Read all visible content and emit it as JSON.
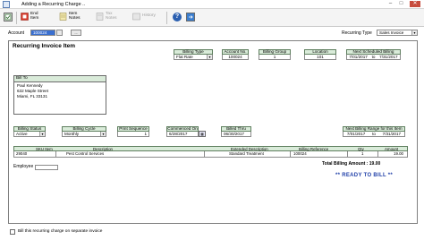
{
  "window": {
    "title": "Adding a Recurring Charge ..",
    "controls": [
      "minimize",
      "maximize",
      "close"
    ]
  },
  "toolbar": {
    "end_item_label": "End Item",
    "item_notes_label": "Item Notes",
    "tax_notes_label": "Tax Notes",
    "history_label": "History",
    "end_item_line1": "End",
    "end_item_line2": "Item",
    "item_notes_line1": "Item",
    "item_notes_line2": "Notes",
    "tax_notes_line1": "Tax",
    "tax_notes_line2": "Notes"
  },
  "account": {
    "label": "Account",
    "value": "100024",
    "recurring_type_label": "Recurring Type",
    "recurring_type_value": "Sales Invoice"
  },
  "panel": {
    "title": "Recurring Invoice Item"
  },
  "top_fields": {
    "billing_type": {
      "label": "Billing Type",
      "value": "Flat Rate"
    },
    "account_no": {
      "label": "Account No.",
      "value": "100024"
    },
    "billing_group": {
      "label": "Billing Group",
      "value": "1"
    },
    "location": {
      "label": "Location",
      "value": "101"
    },
    "next_scheduled_billing": {
      "label": "Next Scheduled Billing",
      "from": "7/01/2017",
      "to_label": "to",
      "to": "7/31/2017"
    }
  },
  "bill_to": {
    "label": "Bill To",
    "lines": [
      "Paul Kennedy",
      "632 Maple Street",
      "Miami, FL 33131"
    ]
  },
  "mid_fields": {
    "billing_status": {
      "label": "Billing Status",
      "value": "Active"
    },
    "billing_cycle": {
      "label": "Billing Cycle",
      "value": "Monthly"
    },
    "print_sequence": {
      "label": "Print Sequence",
      "value": "1"
    },
    "commenced_on": {
      "label": "Commenced On",
      "value": "6/28/2017"
    },
    "billed_thru": {
      "label": "Billed Thru",
      "value": "06/30/2017"
    },
    "next_billing_range": {
      "label": "Next Billing Range for this Item",
      "from": "7/01/2017",
      "to_label": "to",
      "to": "7/31/2017"
    }
  },
  "items_table": {
    "columns": [
      "SKU Item",
      "Description",
      "Extended Description",
      "Billing Reference",
      "Qty",
      "Amount"
    ],
    "rows": [
      {
        "sku": "29040",
        "description": "Pest Control Services",
        "extended_description": "Standard Treatment",
        "billing_reference": "100024",
        "qty": "1",
        "amount": "19.00"
      }
    ]
  },
  "totals": {
    "label": "Total Billing Amount :",
    "value": "19.00"
  },
  "employee": {
    "label": "Employee"
  },
  "status": {
    "text": "** READY TO BILL **"
  },
  "footer": {
    "checkbox_label": "Bill this recurring charge on separate invoice",
    "checked": false
  },
  "colors": {
    "header_bg": "#d9ebd9",
    "status_text": "#1f3fa8",
    "close_button": "#c74b3c"
  }
}
